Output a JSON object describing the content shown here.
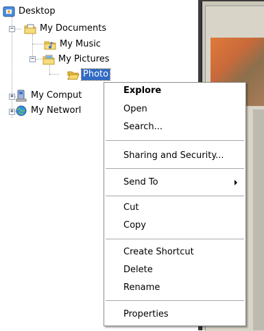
{
  "tree": {
    "desktop": "Desktop",
    "my_documents": "My Documents",
    "my_music": "My Music",
    "my_pictures": "My Pictures",
    "photo": "Photo",
    "my_computer": "My Comput",
    "my_network": "My Networl"
  },
  "menu": {
    "explore": "Explore",
    "open": "Open",
    "search": "Search...",
    "sharing": "Sharing and Security...",
    "send_to": "Send To",
    "cut": "Cut",
    "copy": "Copy",
    "create_shortcut": "Create Shortcut",
    "delete": "Delete",
    "rename": "Rename",
    "properties": "Properties"
  },
  "colors": {
    "selection": "#316ac5",
    "folder": "#f3cf5b"
  }
}
